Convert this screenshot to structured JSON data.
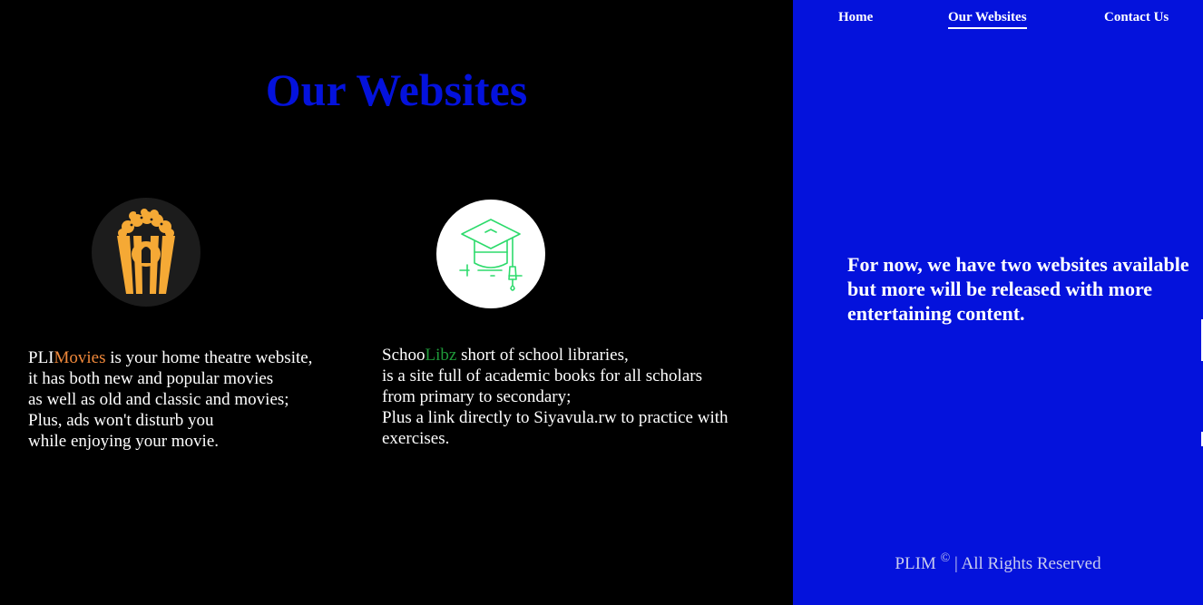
{
  "colors": {
    "background": "#000000",
    "brand_blue": "#0412dc",
    "movies_orange": "#f0883a",
    "schoo_green": "#1f9a3a",
    "popcorn_yellow": "#f5a935",
    "cap_green": "#2ddb6c",
    "text_white": "#ffffff",
    "footer_text": "#c9ccef"
  },
  "nav": {
    "home": "Home",
    "websites": "Our Websites",
    "contact": "Contact Us",
    "active": "Our Websites"
  },
  "page": {
    "title": "Our Websites"
  },
  "sites": [
    {
      "icon": "popcorn-icon",
      "name_prefix": "PLI",
      "name_accent": "Movies",
      "lines": [
        " is your home theatre website,",
        "it has both new and popular movies",
        "as well as old and classic and movies;",
        "Plus, ads won't disturb you",
        "while enjoying your movie."
      ]
    },
    {
      "icon": "graduation-cap-icon",
      "name_prefix": "Schoo",
      "name_accent": "Libz",
      "lines": [
        " short of school libraries,",
        "is a site full of academic books for all scholars",
        "from primary to secondary;",
        "Plus a link directly to Siyavula.rw to practice with",
        "exercises."
      ]
    }
  ],
  "side": {
    "blurb": "For now, we have two websites available but more will be released with more entertaining content."
  },
  "footer": {
    "brand": "PLIM",
    "copyright_symbol": "©",
    "rights": "| All Rights Reserved"
  }
}
